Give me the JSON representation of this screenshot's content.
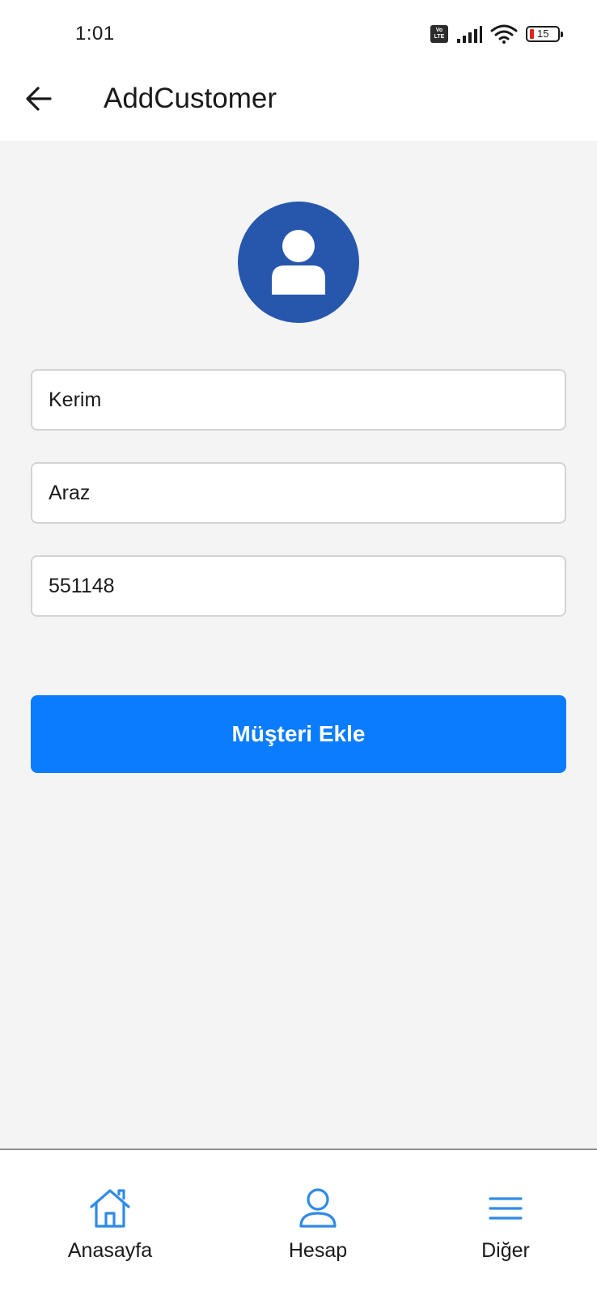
{
  "status_bar": {
    "time": "1:01",
    "battery_level": "15",
    "volte_top": "Vo",
    "volte_bottom": "LTE",
    "icons": [
      "volte-icon",
      "signal-icon",
      "wifi-icon",
      "battery-icon"
    ]
  },
  "header": {
    "back_icon": "arrow-left-icon",
    "title": "AddCustomer"
  },
  "form": {
    "avatar_icon": "user-icon",
    "first_name_value": "Kerim",
    "last_name_value": "Araz",
    "phone_value": "551148",
    "submit_label": "Müşteri Ekle"
  },
  "bottom_nav": {
    "items": [
      {
        "label": "Anasayfa",
        "icon": "home-icon"
      },
      {
        "label": "Hesap",
        "icon": "user-outline-icon"
      },
      {
        "label": "Diğer",
        "icon": "menu-icon"
      }
    ]
  },
  "colors": {
    "primary": "#0a7cff",
    "avatar_bg": "#2757ad",
    "nav_icon": "#2f8be6",
    "content_bg": "#f4f4f4",
    "battery_low": "#e0261b"
  }
}
